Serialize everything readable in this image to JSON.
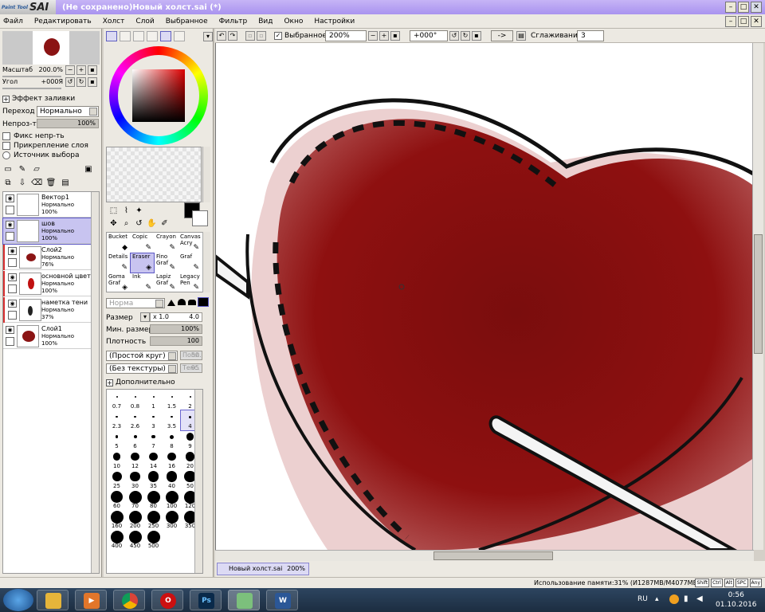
{
  "window": {
    "logo_small": "Paint Tool",
    "logo_big": "SAI",
    "title": "(Не сохранено)Новый холст.sai (*)"
  },
  "menu": [
    "Файл",
    "Редактировать",
    "Холст",
    "Слой",
    "Выбранное",
    "Фильтр",
    "Вид",
    "Окно",
    "Настройки"
  ],
  "navigator": {
    "zoom_label": "Масштаб",
    "zoom_value": "200.0%",
    "angle_label": "Угол",
    "angle_value": "+000Я"
  },
  "layer_props": {
    "fill_effect": "Эффект заливки",
    "blend_label": "Переход",
    "blend_value": "Нормально",
    "opacity_label": "Непроз-ть",
    "opacity_value": "100%",
    "lock_opacity": "Фикс непр-ть",
    "clipping": "Прикрепление слоя",
    "selection_source": "Источник выбора"
  },
  "layers": [
    {
      "name": "Вектор1",
      "mode": "Нормально",
      "opacity": "100%"
    },
    {
      "name": "шов",
      "mode": "Нормально",
      "opacity": "100%"
    },
    {
      "name": "Слой2",
      "mode": "Нормально",
      "opacity": "76%"
    },
    {
      "name": "основной цвет",
      "mode": "Нормально",
      "opacity": "100%"
    },
    {
      "name": "наметка тени",
      "mode": "Нормально",
      "opacity": "37%"
    },
    {
      "name": "Слой1",
      "mode": "Нормально",
      "opacity": "100%"
    }
  ],
  "brushes": [
    {
      "name": "Bucket",
      "icon": "🪣"
    },
    {
      "name": "Copic",
      "icon": "✎"
    },
    {
      "name": "Crayon",
      "icon": "✎"
    },
    {
      "name": "Canvas Acry",
      "icon": "✎"
    },
    {
      "name": "Details",
      "icon": "✎"
    },
    {
      "name": "Eraser",
      "icon": "◈"
    },
    {
      "name": "Fino Graf",
      "icon": "✎"
    },
    {
      "name": "Graf",
      "icon": "✎"
    },
    {
      "name": "Goma Graf",
      "icon": "◈"
    },
    {
      "name": "Ink",
      "icon": "✎"
    },
    {
      "name": "Lapiz Graf",
      "icon": "✎"
    },
    {
      "name": "Legacy Pen",
      "icon": "✎"
    }
  ],
  "brush_params": {
    "mode_value": "Норма",
    "size_label": "Размер",
    "size_mult": "x 1.0",
    "size_value": "4.0",
    "min_size_label": "Мин. размер",
    "min_size_value": "100%",
    "density_label": "Плотность",
    "density_value": "100",
    "shape_value": "(Простой круг)",
    "shape_num_label": "Попл.",
    "shape_num": "50",
    "texture_value": "(Без текстуры)",
    "texture_num_label": "Текс.",
    "texture_num": "95",
    "advanced": "Дополнительно"
  },
  "sizes": [
    "0.7",
    "0.8",
    "1",
    "1.5",
    "2",
    "2.3",
    "2.6",
    "3",
    "3.5",
    "4",
    "5",
    "6",
    "7",
    "8",
    "9",
    "10",
    "12",
    "14",
    "16",
    "20",
    "25",
    "30",
    "35",
    "40",
    "50",
    "60",
    "70",
    "80",
    "100",
    "120",
    "160",
    "200",
    "250",
    "300",
    "350",
    "400",
    "450",
    "500"
  ],
  "canvas_toolbar": {
    "selection_label": "Выбранное",
    "zoom_value": "200%",
    "angle_value": "+000°",
    "arrow_button": "->",
    "smoothing_label": "Сглаживание",
    "smoothing_value": "3"
  },
  "doc_tab": {
    "name": "Новый холст.sai",
    "zoom": "200%"
  },
  "status": {
    "memory": "Использование памяти:31% (И1287MB/M4077MB)",
    "keys": [
      "Shift",
      "Ctrl",
      "Alt",
      "SPC",
      "Any"
    ]
  },
  "taskbar": {
    "lang": "RU",
    "time": "0:56",
    "date": "01.10.2016"
  },
  "colors": {
    "heart": "#8b0d0d",
    "selection": "#c8c4f0",
    "title_bar": "#a993ef"
  }
}
